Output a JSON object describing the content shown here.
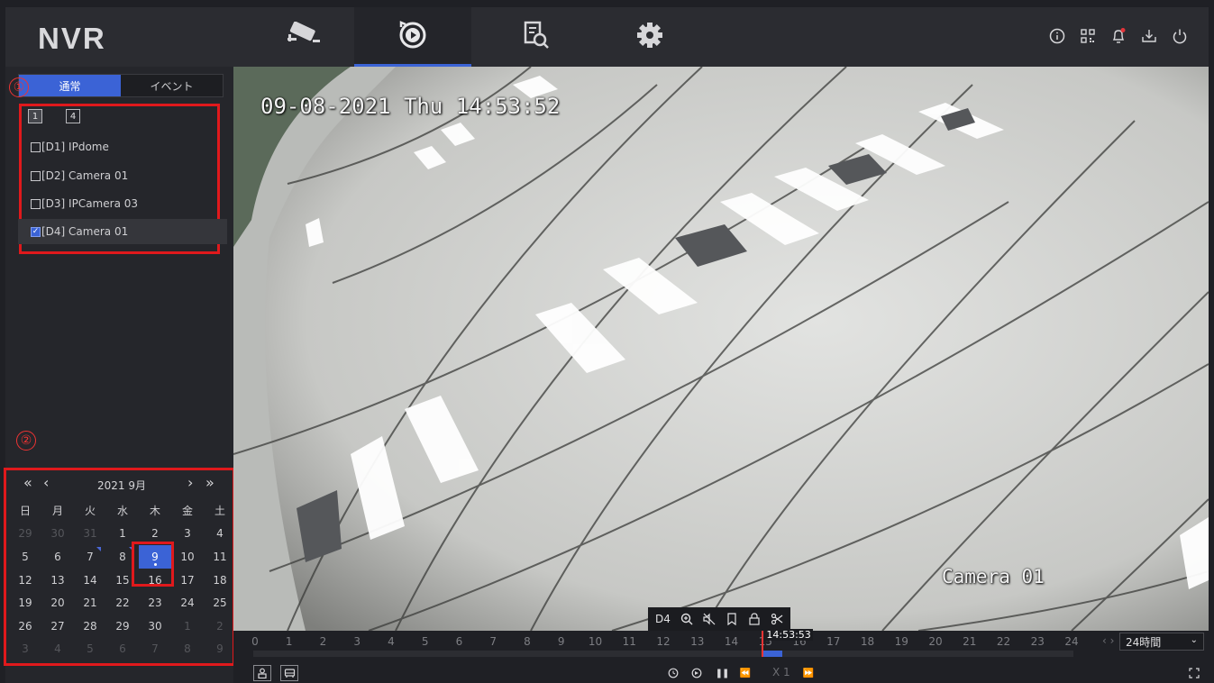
{
  "app": {
    "logo": "NVR"
  },
  "nav": {
    "tabs": [
      {
        "name": "live-view",
        "icon": "camera-icon",
        "active": false
      },
      {
        "name": "playback",
        "icon": "playback-icon",
        "active": true
      },
      {
        "name": "search",
        "icon": "file-search-icon",
        "active": false
      },
      {
        "name": "settings",
        "icon": "gear-icon",
        "active": false
      }
    ],
    "right_icons": [
      "info-icon",
      "qr-code-icon",
      "bell-icon",
      "download-icon",
      "power-icon"
    ]
  },
  "left_panel": {
    "mode_tabs": {
      "normal": "通常",
      "event": "イベント"
    },
    "annotations": {
      "one": "①",
      "two": "②"
    },
    "split_buttons": [
      "1",
      "4"
    ],
    "cameras": [
      {
        "label": "[D1] IPdome",
        "checked": false
      },
      {
        "label": "[D2] Camera 01",
        "checked": false
      },
      {
        "label": "[D3] IPCamera 03",
        "checked": false
      },
      {
        "label": "[D4] Camera 01",
        "checked": true
      }
    ]
  },
  "calendar": {
    "prev_year": "«",
    "prev_month": "‹",
    "title": "2021 9月",
    "next_month": "›",
    "next_year": "»",
    "weekdays": [
      "日",
      "月",
      "火",
      "水",
      "木",
      "金",
      "土"
    ],
    "days": [
      {
        "d": "29",
        "dim": true
      },
      {
        "d": "30",
        "dim": true
      },
      {
        "d": "31",
        "dim": true
      },
      {
        "d": "1"
      },
      {
        "d": "2"
      },
      {
        "d": "3"
      },
      {
        "d": "4"
      },
      {
        "d": "5"
      },
      {
        "d": "6"
      },
      {
        "d": "7",
        "mark": true
      },
      {
        "d": "8",
        "mark": true
      },
      {
        "d": "9",
        "today": true
      },
      {
        "d": "10"
      },
      {
        "d": "11"
      },
      {
        "d": "12"
      },
      {
        "d": "13"
      },
      {
        "d": "14"
      },
      {
        "d": "15"
      },
      {
        "d": "16"
      },
      {
        "d": "17"
      },
      {
        "d": "18"
      },
      {
        "d": "19"
      },
      {
        "d": "20"
      },
      {
        "d": "21"
      },
      {
        "d": "22"
      },
      {
        "d": "23"
      },
      {
        "d": "24"
      },
      {
        "d": "25"
      },
      {
        "d": "26"
      },
      {
        "d": "27"
      },
      {
        "d": "28"
      },
      {
        "d": "29"
      },
      {
        "d": "30"
      },
      {
        "d": "1",
        "dim": true
      },
      {
        "d": "2",
        "dim": true
      },
      {
        "d": "3",
        "dim": true
      },
      {
        "d": "4",
        "dim": true
      },
      {
        "d": "5",
        "dim": true
      },
      {
        "d": "6",
        "dim": true
      },
      {
        "d": "7",
        "dim": true
      },
      {
        "d": "8",
        "dim": true
      },
      {
        "d": "9",
        "dim": true
      }
    ]
  },
  "video": {
    "osd_timestamp": "09-08-2021 Thu 14:53:52",
    "osd_camera": "Camera 01",
    "toolbar": {
      "channel": "D4",
      "icons": [
        "zoom-in-icon",
        "mute-icon",
        "bookmark-icon",
        "lock-icon",
        "clip-icon"
      ]
    }
  },
  "timeline": {
    "hours": [
      "0",
      "1",
      "2",
      "3",
      "4",
      "5",
      "6",
      "7",
      "8",
      "9",
      "10",
      "11",
      "12",
      "13",
      "14",
      "15",
      "16",
      "17",
      "18",
      "19",
      "20",
      "21",
      "22",
      "23",
      "24"
    ],
    "cursor_time": "14:53:53",
    "cursor_hour": 14.898,
    "recording": {
      "start_hour": 14.9,
      "end_hour": 15.5
    },
    "pager": "‹  ›",
    "zoom": "24時間",
    "zoom_arrow": "⌄",
    "speed": "X 1",
    "controls": {
      "pause": "❚❚",
      "rewind": "⏪",
      "forward": "⏩"
    }
  },
  "colors": {
    "accent": "#3b63d6",
    "highlight_red": "#e0191c",
    "panel": "#25262b",
    "topbar": "#2b2c31"
  }
}
